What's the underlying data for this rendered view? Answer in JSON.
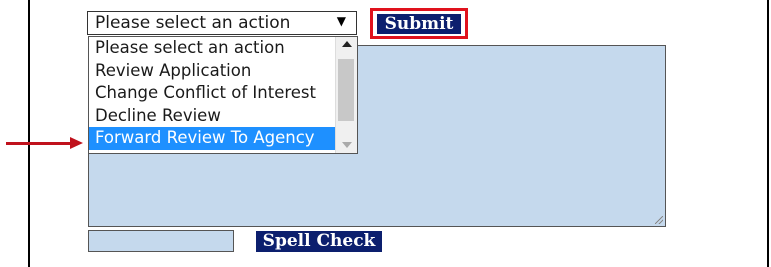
{
  "action_select": {
    "value": "Please select an action",
    "options": [
      "Please select an action",
      "Review Application",
      "Change Conflict of Interest",
      "Decline Review",
      "Forward Review To Agency"
    ],
    "highlighted_option": "Forward Review To Agency",
    "dropdown_icon": "triangle-down"
  },
  "submit_button": {
    "label": "Submit",
    "highlight_color": "#e0121d"
  },
  "comment_textarea": {
    "value": ""
  },
  "spell_check": {
    "input_value": "",
    "button_label": "Spell Check"
  },
  "annotation": {
    "arrow_color": "#c0111c",
    "points_to": "Forward Review To Agency"
  },
  "colors": {
    "button_bg": "#0c1f6e",
    "field_bg": "#c5d9ed",
    "selected_option_bg": "#1e90ff"
  }
}
